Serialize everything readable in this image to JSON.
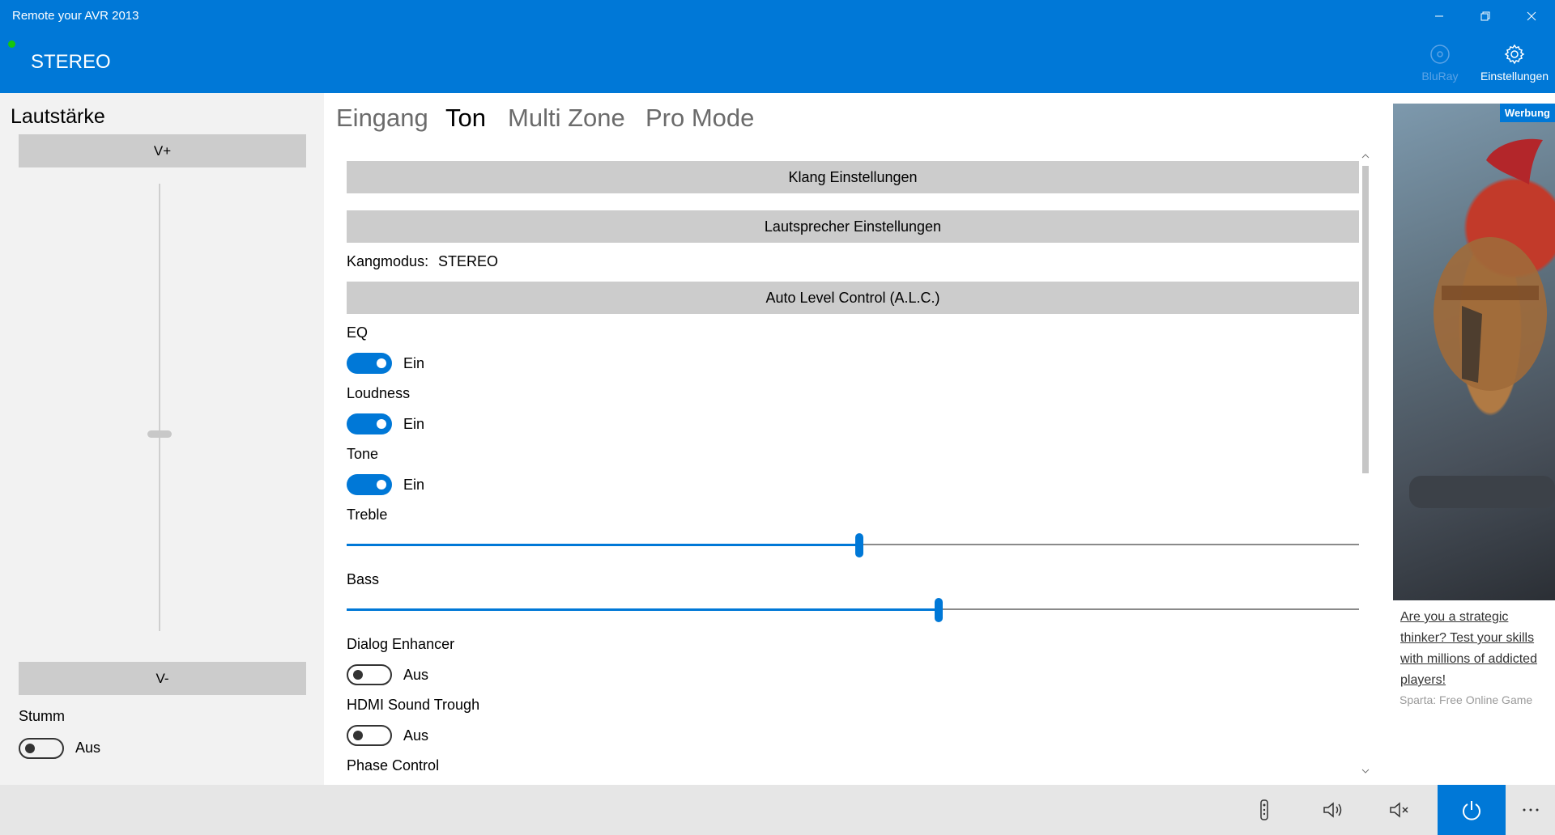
{
  "header": {
    "app_title": "Remote your AVR 2013",
    "mode": "STEREO",
    "commands": [
      {
        "label": "BluRay",
        "icon": "disc-icon",
        "enabled": false
      },
      {
        "label": "Einstellungen",
        "icon": "gear-icon",
        "enabled": true
      }
    ]
  },
  "volume": {
    "title": "Lautstärke",
    "up_label": "V+",
    "down_label": "V-",
    "mute_label": "Stumm",
    "mute_state": "Aus"
  },
  "tabs": [
    "Eingang",
    "Ton",
    "Multi Zone",
    "Pro Mode"
  ],
  "active_tab": "Ton",
  "settings": {
    "klang_header": "Klang Einstellungen",
    "speaker_header": "Lautsprecher Einstellungen",
    "mode_label": "Kangmodus:",
    "mode_value": "STEREO",
    "alc_header": "Auto Level Control (A.L.C.)",
    "eq": {
      "label": "EQ",
      "state": "Ein"
    },
    "loudness": {
      "label": "Loudness",
      "state": "Ein"
    },
    "tone": {
      "label": "Tone",
      "state": "Ein"
    },
    "treble": {
      "label": "Treble",
      "level": 0.506
    },
    "bass": {
      "label": "Bass",
      "level": 0.585
    },
    "dialog_enhancer": {
      "label": "Dialog Enhancer",
      "state": "Aus"
    },
    "hdmi_sound": {
      "label": "HDMI Sound Trough",
      "state": "Aus"
    },
    "phase_control": {
      "label": "Phase Control"
    }
  },
  "ad": {
    "badge": "Werbung",
    "text": "Are you a strategic thinker? Test your skills with millions of addicted players!",
    "source": "Sparta: Free Online Game"
  },
  "colors": {
    "accent": "#0078d7",
    "panel": "#f2f2f2",
    "section": "#cccccc",
    "bottom_bar": "#e6e6e6"
  }
}
